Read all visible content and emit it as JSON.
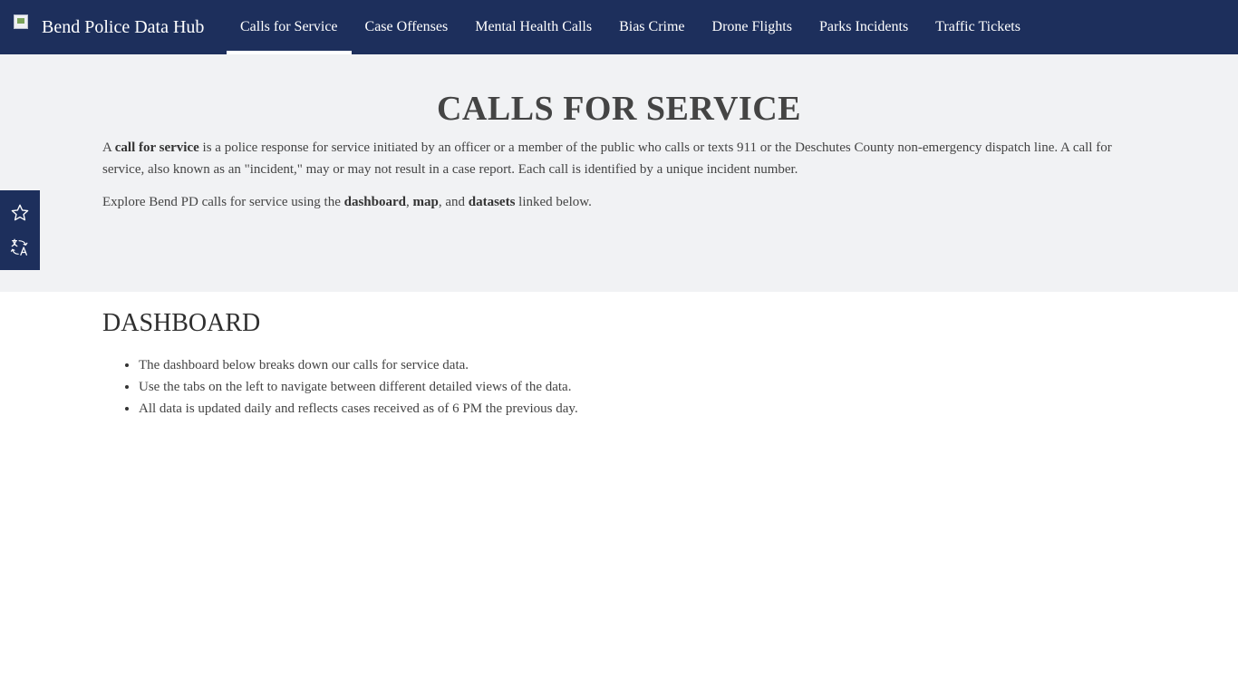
{
  "header": {
    "site_title": "Bend Police Data Hub",
    "nav": [
      {
        "label": "Calls for Service",
        "active": true
      },
      {
        "label": "Case Offenses",
        "active": false
      },
      {
        "label": "Mental Health Calls",
        "active": false
      },
      {
        "label": "Bias Crime",
        "active": false
      },
      {
        "label": "Drone Flights",
        "active": false
      },
      {
        "label": "Parks Incidents",
        "active": false
      },
      {
        "label": "Traffic Tickets",
        "active": false
      }
    ]
  },
  "hero": {
    "title": "CALLS FOR SERVICE",
    "p1": {
      "pre": "A ",
      "term": "call for service",
      "post": " is a police response for service initiated by an officer or a member of the public who calls or texts 911 or the Deschutes County non-emergency dispatch line. A call for service, also known as an \"incident,\" may or may not result in a case report. Each call is identified by a unique incident number."
    },
    "p2": {
      "pre": "Explore Bend PD calls for service using the ",
      "b1": "dashboard",
      "sep1": ", ",
      "b2": "map",
      "sep2": ", and ",
      "b3": "datasets",
      "post": " linked below."
    }
  },
  "side_toolbar": {
    "icons": [
      "star-icon",
      "translate-icon"
    ]
  },
  "dashboard": {
    "title": "DASHBOARD",
    "bullets": [
      "The dashboard below breaks down our calls for service data.",
      "Use the tabs on the left to navigate between different detailed views of the data.",
      "All data is updated daily and reflects cases received as of 6 PM the previous day."
    ]
  },
  "colors": {
    "nav_bg": "#1d2f5c",
    "hero_bg": "#f1f2f4",
    "text": "#444444"
  }
}
